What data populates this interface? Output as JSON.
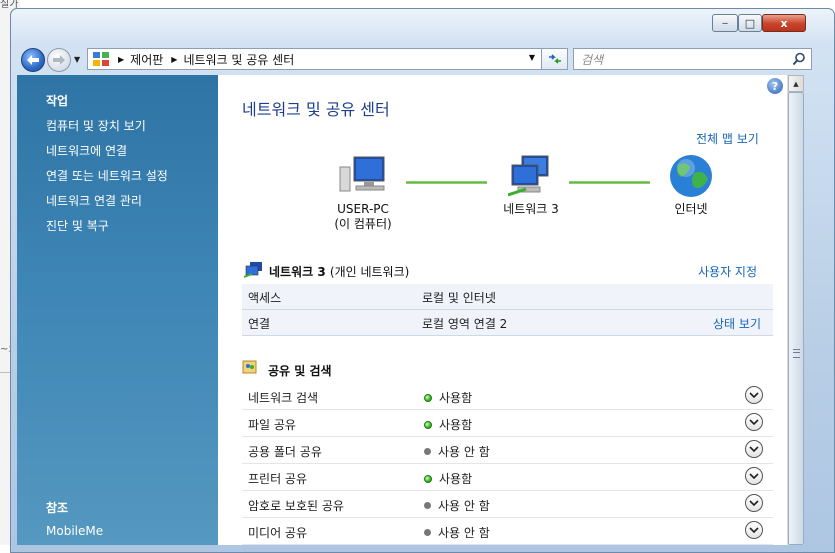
{
  "desktop": {
    "top_text": "실가",
    "side_text": "~오"
  },
  "window_buttons": {
    "minimize": "‒",
    "maximize": "□",
    "close": "x"
  },
  "nav": {
    "breadcrumbs": [
      "제어판",
      "네트워크 및 공유 센터"
    ],
    "search_placeholder": "검색"
  },
  "sidebar": {
    "tasks_heading": "작업",
    "tasks": [
      "컴퓨터 및 장치 보기",
      "네트워크에 연결",
      "연결 또는 네트워크 설정",
      "네트워크 연결 관리",
      "진단 및 복구"
    ],
    "see_also_heading": "참조",
    "see_also": [
      "MobileMe"
    ]
  },
  "main": {
    "title": "네트워크 및 공유 센터",
    "full_map_link": "전체 맵 보기",
    "map": {
      "computer_name": "USER-PC",
      "computer_sub": "(이 컴퓨터)",
      "network_name": "네트워크  3",
      "internet_name": "인터넷"
    },
    "network": {
      "name": "네트워크  3",
      "type": "(개인 네트워크)",
      "customize_link": "사용자 지정",
      "rows": [
        {
          "label": "액세스",
          "value": "로컬 및 인터넷",
          "action": ""
        },
        {
          "label": "연결",
          "value": "로컬 영역 연결 2",
          "action": "상태 보기"
        }
      ]
    },
    "sharing": {
      "title": "공유 및 검색",
      "items": [
        {
          "label": "네트워크 검색",
          "status": "사용함",
          "on": true
        },
        {
          "label": "파일 공유",
          "status": "사용함",
          "on": true
        },
        {
          "label": "공용 폴더 공유",
          "status": "사용 안 함",
          "on": false
        },
        {
          "label": "프린터 공유",
          "status": "사용함",
          "on": true
        },
        {
          "label": "암호로 보호된 공유",
          "status": "사용 안 함",
          "on": false
        },
        {
          "label": "미디어 공유",
          "status": "사용 안 함",
          "on": false
        }
      ]
    }
  },
  "colors": {
    "title_blue": "#1e3f8e",
    "link_blue": "#1565b9",
    "sidebar_blue": "#3e86b6",
    "status_green": "#2aa615"
  }
}
